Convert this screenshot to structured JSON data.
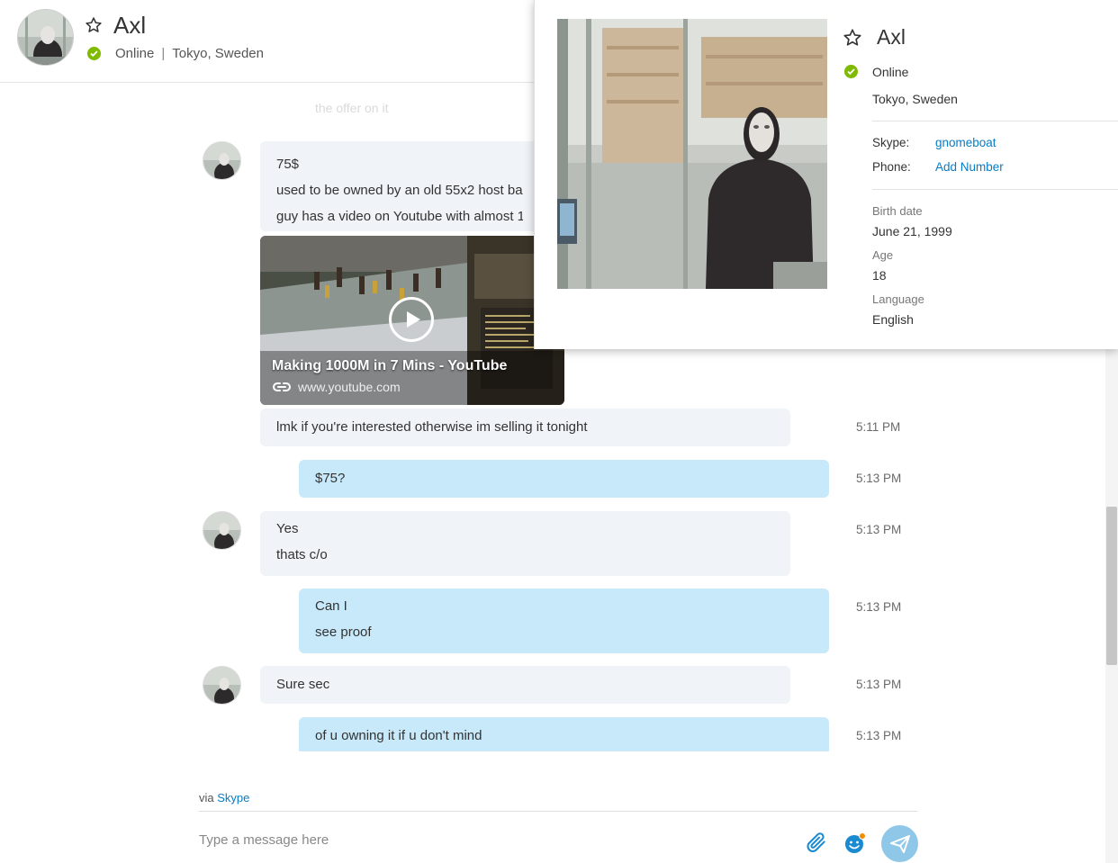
{
  "header": {
    "name": "Axl",
    "status": "Online",
    "separator": "|",
    "location": "Tokyo, Sweden"
  },
  "faded_message": "the offer on it",
  "messages": {
    "m1": {
      "lines": [
        "75$",
        "used to be owned by an old 55x2 host ba",
        "guy has a video on Youtube with almost 1"
      ]
    },
    "youtube": {
      "title": "Making 1000M in 7 Mins - YouTube",
      "url": "www.youtube.com"
    },
    "m2": {
      "text": "lmk if you're interested otherwise im selling it tonight",
      "time": "5:11 PM"
    },
    "m3": {
      "text": "$75?",
      "time": "5:13 PM"
    },
    "m4": {
      "lines": [
        "Yes",
        "thats c/o"
      ],
      "time": "5:13 PM"
    },
    "m5": {
      "lines": [
        "Can I",
        "see proof"
      ],
      "time": "5:13 PM"
    },
    "m6": {
      "text": "Sure sec",
      "time": "5:13 PM"
    },
    "m7": {
      "text": "of u owning it if u don't mind",
      "time": "5:13 PM"
    }
  },
  "composer": {
    "via_prefix": "via",
    "via_link": "Skype",
    "placeholder": "Type a message here"
  },
  "profile": {
    "name": "Axl",
    "status": "Online",
    "location": "Tokyo, Sweden",
    "skype_label": "Skype:",
    "skype_value": "gnomeboat",
    "phone_label": "Phone:",
    "phone_value": "Add Number",
    "birth_label": "Birth date",
    "birth_value": "June 21, 1999",
    "age_label": "Age",
    "age_value": "18",
    "language_label": "Language",
    "language_value": "English"
  },
  "colors": {
    "online": "#7fba00",
    "incoming_bubble": "#f0f3f7",
    "outgoing_bubble": "#c7e9fa",
    "link": "#0a7cc1",
    "send_button": "#8fc7e8"
  }
}
